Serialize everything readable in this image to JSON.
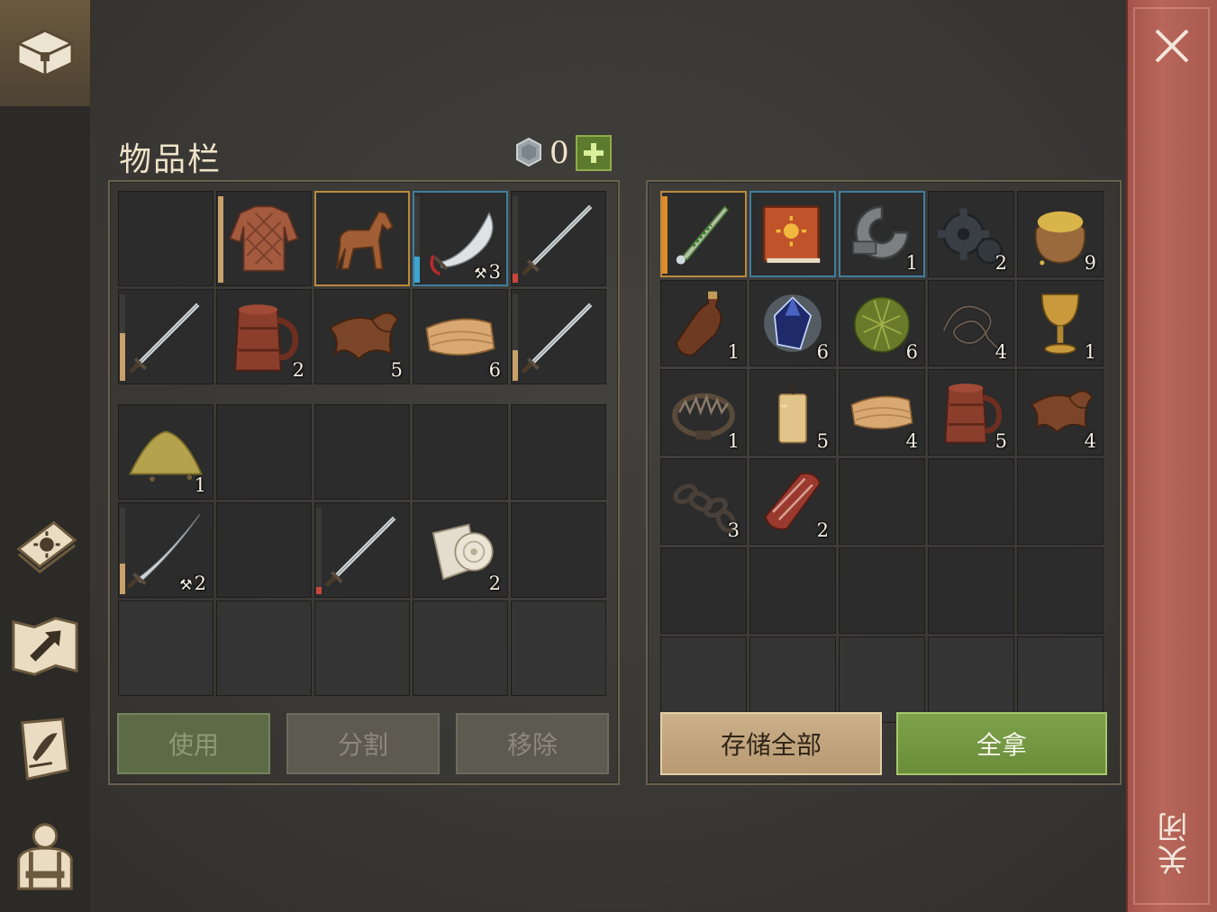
{
  "inventory": {
    "title": "物品栏",
    "currency_value": "0",
    "buttons": {
      "use": "使用",
      "split": "分割",
      "remove": "移除"
    },
    "equipped": [
      {
        "icon": "empty"
      },
      {
        "icon": "gambeson-armor-icon",
        "bar_color": "#c8a06a",
        "bar_level": 1.0
      },
      {
        "icon": "horse-icon",
        "frame": "gold"
      },
      {
        "icon": "scimitar-icon",
        "frame": "blue",
        "bar_color": "#3da5cf",
        "bar_level": 0.3,
        "badge": "3"
      },
      {
        "icon": "sword-icon",
        "bar_color": "#c8463a",
        "bar_level": 0.1
      },
      {
        "icon": "sword-icon",
        "bar_color": "#c8a06a",
        "bar_level": 0.55
      },
      {
        "icon": "tankard-icon",
        "qty": "2"
      },
      {
        "icon": "leather-icon",
        "qty": "5"
      },
      {
        "icon": "cloth-icon",
        "qty": "6"
      },
      {
        "icon": "sword-icon",
        "bar_color": "#c8a06a",
        "bar_level": 0.35
      }
    ],
    "backpack": [
      {
        "icon": "sand-pile-icon",
        "qty": "1"
      },
      {
        "icon": "empty"
      },
      {
        "icon": "empty"
      },
      {
        "icon": "empty"
      },
      {
        "icon": "empty"
      },
      {
        "icon": "saber-icon",
        "bar_color": "#c8a06a",
        "bar_level": 0.35,
        "badge": "2"
      },
      {
        "icon": "empty"
      },
      {
        "icon": "sword-icon",
        "bar_color": "#c8463a",
        "bar_level": 0.08
      },
      {
        "icon": "bandage-roll-icon",
        "qty": "2"
      },
      {
        "icon": "empty"
      },
      {
        "icon": "faded"
      },
      {
        "icon": "faded"
      },
      {
        "icon": "faded"
      },
      {
        "icon": "faded"
      },
      {
        "icon": "faded"
      }
    ]
  },
  "storage": {
    "buttons": {
      "store_all": "存储全部",
      "take_all": "全拿"
    },
    "items": [
      {
        "icon": "poisoned-dagger-icon",
        "frame": "gold",
        "bar_color": "#e08a2a",
        "bar_level": 1.0
      },
      {
        "icon": "sun-book-icon",
        "frame": "blue"
      },
      {
        "icon": "iron-clamp-icon",
        "frame": "blue",
        "qty": "1"
      },
      {
        "icon": "gear-icon",
        "qty": "2"
      },
      {
        "icon": "grain-sack-icon",
        "qty": "9"
      },
      {
        "icon": "leather-flask-icon",
        "qty": "1"
      },
      {
        "icon": "crystal-icon",
        "qty": "6"
      },
      {
        "icon": "herb-ball-icon",
        "qty": "6"
      },
      {
        "icon": "rope-icon",
        "qty": "4"
      },
      {
        "icon": "goblet-icon",
        "qty": "1"
      },
      {
        "icon": "bear-trap-icon",
        "qty": "1"
      },
      {
        "icon": "candle-icon",
        "qty": "5"
      },
      {
        "icon": "cloth-icon",
        "qty": "4"
      },
      {
        "icon": "tankard-icon",
        "qty": "5"
      },
      {
        "icon": "leather-icon",
        "qty": "4"
      },
      {
        "icon": "chain-icon",
        "qty": "3"
      },
      {
        "icon": "raw-meat-icon",
        "qty": "2"
      },
      {
        "icon": "empty"
      },
      {
        "icon": "empty"
      },
      {
        "icon": "empty"
      },
      {
        "icon": "empty"
      },
      {
        "icon": "empty"
      },
      {
        "icon": "empty"
      },
      {
        "icon": "empty"
      },
      {
        "icon": "empty"
      },
      {
        "icon": "faded"
      },
      {
        "icon": "faded"
      },
      {
        "icon": "faded"
      },
      {
        "icon": "faded"
      },
      {
        "icon": "faded"
      }
    ]
  },
  "close": {
    "label": "关闭"
  },
  "sidebar": {
    "icons": [
      "chest-icon",
      "sun-book-icon",
      "crafting-hammer-icon",
      "quest-scroll-icon",
      "character-icon"
    ]
  },
  "colors": {
    "take_all_green": "#7ea14a",
    "store_all_tan": "#cbb08a",
    "close_bar_red": "#b8665a"
  }
}
